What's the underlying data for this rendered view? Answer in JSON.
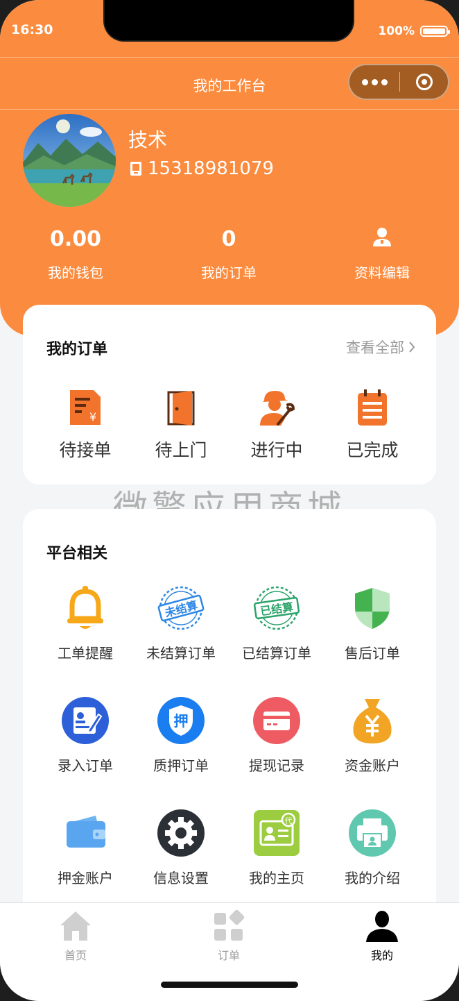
{
  "status": {
    "time": "16:30",
    "battery": "100%"
  },
  "nav": {
    "title": "我的工作台"
  },
  "user": {
    "name": "技术",
    "phone": "15318981079"
  },
  "stats": [
    {
      "value": "0.00",
      "label": "我的钱包"
    },
    {
      "value": "0",
      "label": "我的订单"
    },
    {
      "label": "资料编辑",
      "icon": "user-icon"
    }
  ],
  "orders": {
    "title": "我的订单",
    "view_all": "查看全部",
    "items": [
      {
        "label": "待接单",
        "icon": "bill-icon"
      },
      {
        "label": "待上门",
        "icon": "door-icon"
      },
      {
        "label": "进行中",
        "icon": "repairman-icon"
      },
      {
        "label": "已完成",
        "icon": "clipboard-icon"
      }
    ]
  },
  "watermark": "微擎应用商城",
  "platform": {
    "title": "平台相关",
    "items": [
      {
        "label": "工单提醒",
        "icon": "bell-icon"
      },
      {
        "label": "未结算订单",
        "icon": "unsettled-stamp-icon",
        "stamp": "未结算"
      },
      {
        "label": "已结算订单",
        "icon": "settled-stamp-icon",
        "stamp": "已结算"
      },
      {
        "label": "售后订单",
        "icon": "shield-icon"
      },
      {
        "label": "录入订单",
        "icon": "form-edit-icon"
      },
      {
        "label": "质押订单",
        "icon": "pledge-icon",
        "glyph": "押"
      },
      {
        "label": "提现记录",
        "icon": "card-icon"
      },
      {
        "label": "资金账户",
        "icon": "money-bag-icon"
      },
      {
        "label": "押金账户",
        "icon": "wallet-icon"
      },
      {
        "label": "信息设置",
        "icon": "gear-icon"
      },
      {
        "label": "我的主页",
        "icon": "id-card-icon",
        "glyph": "代"
      },
      {
        "label": "我的介绍",
        "icon": "printer-icon"
      }
    ]
  },
  "tabbar": [
    {
      "label": "首页",
      "icon": "home-icon"
    },
    {
      "label": "订单",
      "icon": "grid-icon"
    },
    {
      "label": "我的",
      "icon": "person-icon",
      "active": true
    }
  ],
  "colors": {
    "brand": "#fb8c3f",
    "order_icon": "#f2732b"
  }
}
